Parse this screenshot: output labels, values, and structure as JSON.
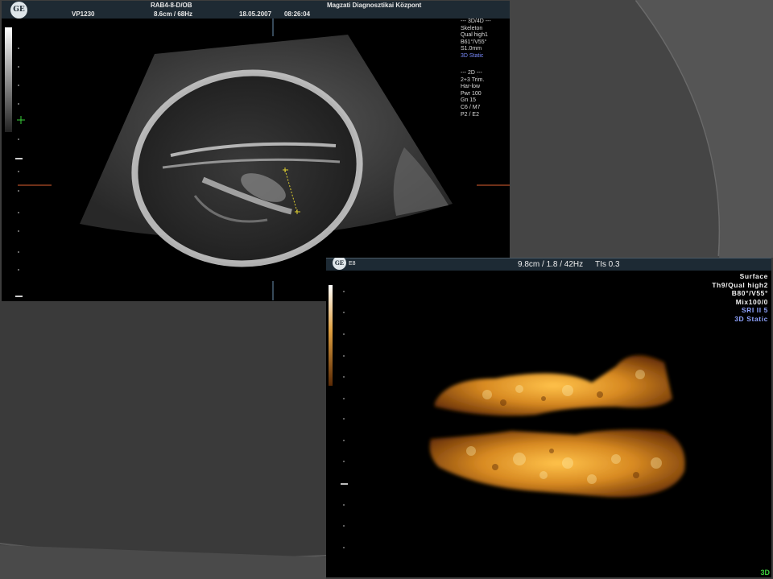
{
  "panel_2d": {
    "header": {
      "logo": "GE",
      "patient_id": "VP1230",
      "probe": "RAB4-8-D/OB",
      "depth_freq": "8.6cm / 68Hz",
      "date": "18.05.2007",
      "time": "08:26:04",
      "institution": "Magzati Diagnosztikai Központ"
    },
    "settings_3d": [
      "--- 3D/4D ---",
      "Skeleton",
      "Qual high1",
      "B61°/V55°",
      "S1.0mm",
      "3D Static"
    ],
    "settings_2d": [
      "--- 2D ---",
      "2+3 Trim.",
      "Har-low",
      "Pwr 100",
      "Gn 15",
      "C6 / M7",
      "P2 / E2"
    ]
  },
  "panel_3d": {
    "header": {
      "logo": "GE",
      "probe_code": "E8",
      "depth_freq": "9.8cm / 1.8 / 42Hz",
      "tis": "TIs  0.3"
    },
    "settings": [
      "Surface",
      "Th9/Qual high2",
      "B80°/V55°",
      "Mix100/0",
      "SRI II 5",
      "3D Static"
    ],
    "mode_label": "3D"
  },
  "colors": {
    "header_bg": "#1e2a33",
    "highlight_text": "#7b8cff",
    "mode_green": "#3dcf3d",
    "render_gold": "#e0a040"
  },
  "icons": [
    "ge-logo-icon",
    "measurement-caliper-icon",
    "crosshair-icon",
    "gray-scale-bar-icon",
    "color-scale-bar-icon"
  ]
}
